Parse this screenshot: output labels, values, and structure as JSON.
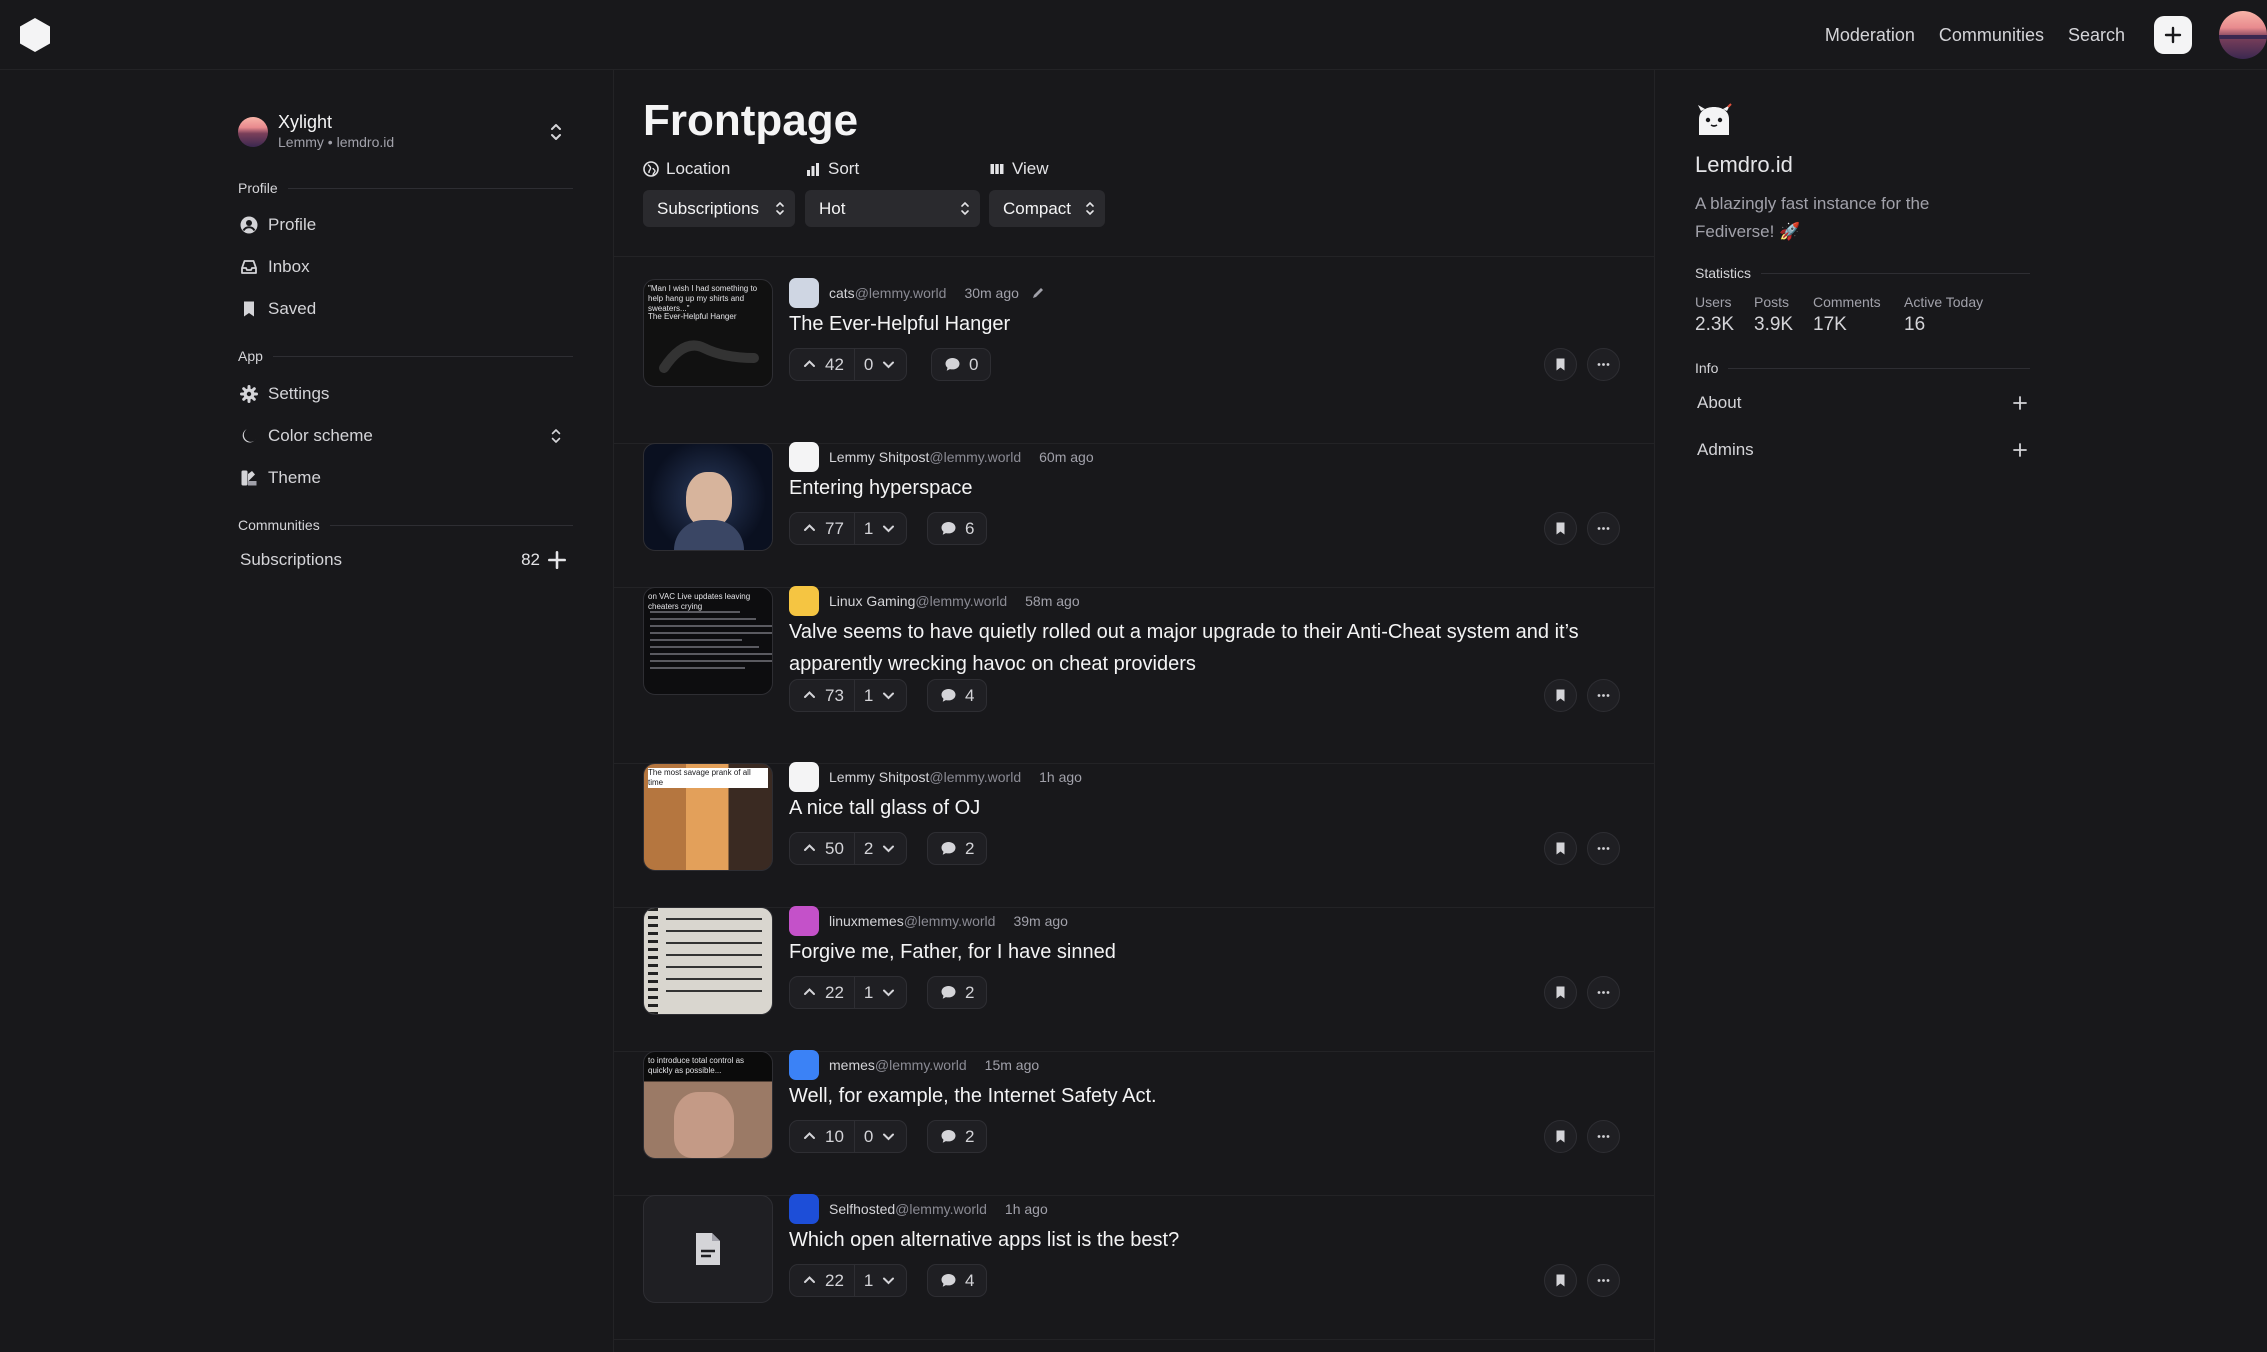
{
  "nav": {
    "links": [
      "Moderation",
      "Communities",
      "Search"
    ]
  },
  "account": {
    "name": "Xylight",
    "instance": "Lemmy • lemdro.id"
  },
  "sidebar": {
    "profile_label": "Profile",
    "profile_items": [
      "Profile",
      "Inbox",
      "Saved"
    ],
    "app_label": "App",
    "app_items": [
      "Settings",
      "Color scheme",
      "Theme"
    ],
    "communities_label": "Communities",
    "subscriptions_label": "Subscriptions",
    "subscriptions_count": "82"
  },
  "main": {
    "title": "Frontpage",
    "filters": {
      "location_label": "Location",
      "location_value": "Subscriptions",
      "sort_label": "Sort",
      "sort_value": "Hot",
      "view_label": "View",
      "view_value": "Compact"
    },
    "posts": [
      {
        "community": "cats",
        "instance": "@lemmy.world",
        "time": "30m ago",
        "title": "The Ever-Helpful Hanger",
        "up": "42",
        "down": "0",
        "comments": "0",
        "edited": true,
        "thumb_text": "\"Man I wish I had something to help hang up my shirts and sweaters...\"",
        "thumb_sub": "The Ever-Helpful Hanger"
      },
      {
        "community": "Lemmy Shitpost",
        "instance": "@lemmy.world",
        "time": "60m ago",
        "title": "Entering hyperspace",
        "up": "77",
        "down": "1",
        "comments": "6"
      },
      {
        "community": "Linux Gaming",
        "instance": "@lemmy.world",
        "time": "58m ago",
        "title": "Valve seems to have quietly rolled out a major upgrade to their Anti-Cheat system and it’s apparently wrecking havoc on cheat providers",
        "up": "73",
        "down": "1",
        "comments": "4",
        "thumb_text": "on VAC Live updates leaving cheaters crying"
      },
      {
        "community": "Lemmy Shitpost",
        "instance": "@lemmy.world",
        "time": "1h ago",
        "title": "A nice tall glass of OJ",
        "up": "50",
        "down": "2",
        "comments": "2",
        "thumb_text": "The most savage prank of all time"
      },
      {
        "community": "linuxmemes",
        "instance": "@lemmy.world",
        "time": "39m ago",
        "title": "Forgive me, Father, for I have sinned",
        "up": "22",
        "down": "1",
        "comments": "2"
      },
      {
        "community": "memes",
        "instance": "@lemmy.world",
        "time": "15m ago",
        "title": "Well, for example, the Internet Safety Act.",
        "up": "10",
        "down": "0",
        "comments": "2",
        "thumb_text": "to introduce total control as quickly as possible..."
      },
      {
        "community": "Selfhosted",
        "instance": "@lemmy.world",
        "time": "1h ago",
        "title": "Which open alternative apps list is the best?",
        "up": "22",
        "down": "1",
        "comments": "4"
      }
    ]
  },
  "instance": {
    "name": "Lemdro.id",
    "description": "A blazingly fast instance for the Fediverse! 🚀",
    "statistics_label": "Statistics",
    "stats": [
      {
        "label": "Users",
        "value": "2.3K"
      },
      {
        "label": "Posts",
        "value": "3.9K"
      },
      {
        "label": "Comments",
        "value": "17K"
      },
      {
        "label": "Active Today",
        "value": "16"
      }
    ],
    "info_label": "Info",
    "info_items": [
      "About",
      "Admins"
    ]
  },
  "colors": {
    "background": "#18181b",
    "surface": "#2a2a2e",
    "border": "#232326",
    "text": "#e4e4e7"
  }
}
